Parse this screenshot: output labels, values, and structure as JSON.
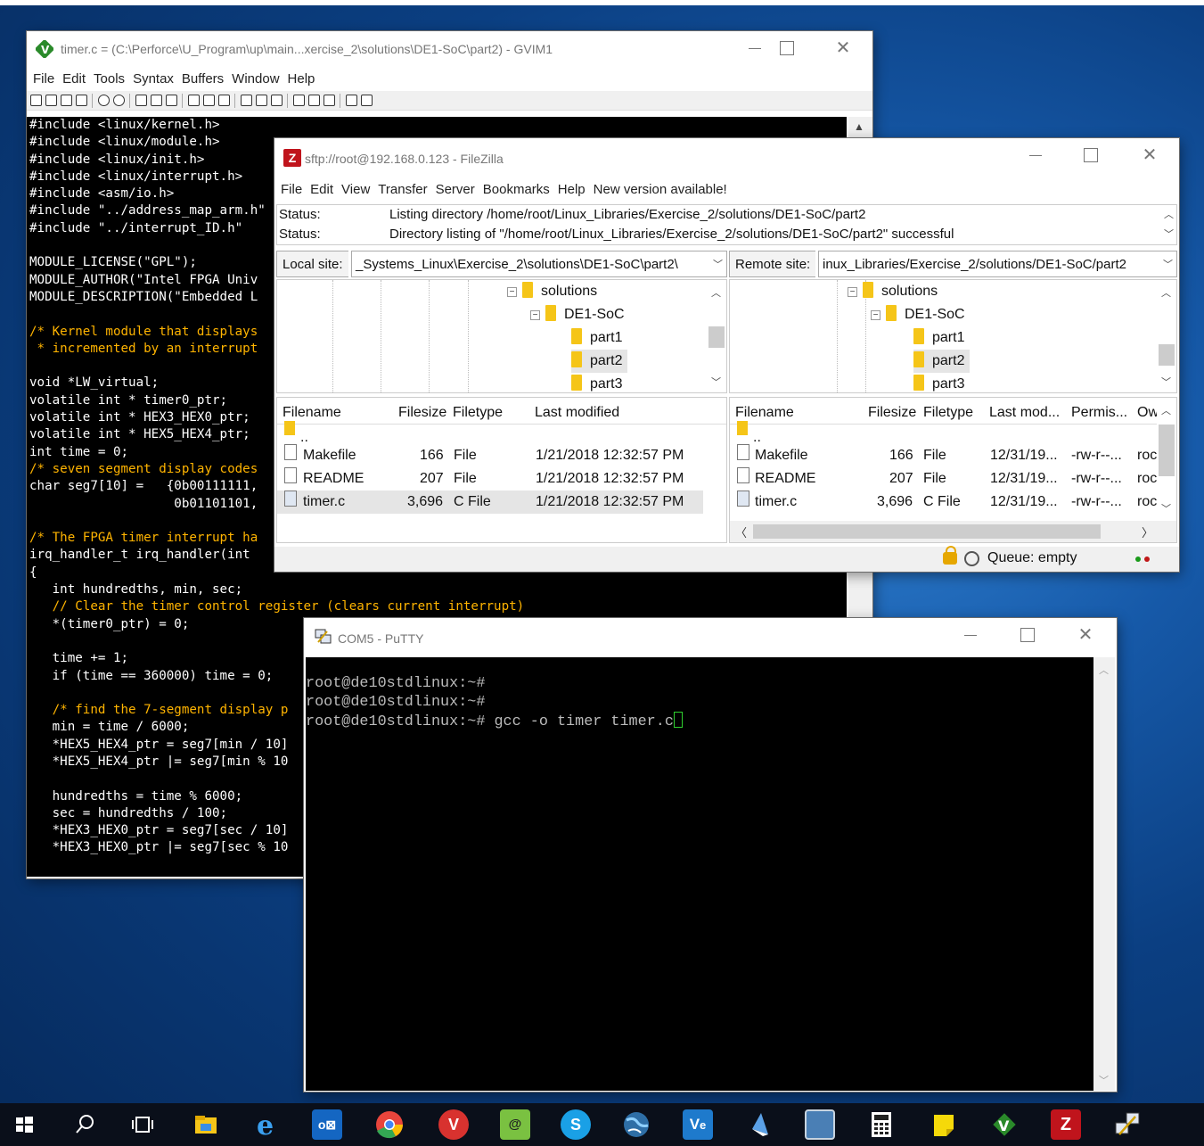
{
  "gvim": {
    "title": "timer.c = (C:\\Perforce\\U_Program\\up\\main...xercise_2\\solutions\\DE1-SoC\\part2) - GVIM1",
    "menu": [
      "File",
      "Edit",
      "Tools",
      "Syntax",
      "Buffers",
      "Window",
      "Help"
    ],
    "code_lines": [
      "#include <linux/kernel.h>",
      "#include <linux/module.h>",
      "#include <linux/init.h>",
      "#include <linux/interrupt.h>",
      "#include <asm/io.h>",
      "#include \"../address_map_arm.h\"",
      "#include \"../interrupt_ID.h\"",
      "",
      "MODULE_LICENSE(\"GPL\");",
      "MODULE_AUTHOR(\"Intel FPGA Univ",
      "MODULE_DESCRIPTION(\"Embedded L",
      "",
      "/* Kernel module that displays",
      " * incremented by an interrupt",
      "",
      "void *LW_virtual;",
      "volatile int * timer0_ptr;",
      "volatile int * HEX3_HEX0_ptr;",
      "volatile int * HEX5_HEX4_ptr;",
      "int time = 0;",
      "/* seven segment display codes",
      "char seg7[10] =   {0b00111111,",
      "                   0b01101101,",
      "",
      "/* The FPGA timer interrupt ha",
      "irq_handler_t irq_handler(int",
      "{",
      "   int hundredths, min, sec;",
      "   // Clear the timer control register (clears current interrupt)",
      "   *(timer0_ptr) = 0;",
      "",
      "   time += 1;",
      "   if (time == 360000) time = 0;",
      "",
      "   /* find the 7-segment display p",
      "   min = time / 6000;",
      "   *HEX5_HEX4_ptr = seg7[min / 10]",
      "   *HEX5_HEX4_ptr |= seg7[min % 10",
      "",
      "   hundredths = time % 6000;",
      "   sec = hundredths / 100;",
      "   *HEX3_HEX0_ptr = seg7[sec / 10]",
      "   *HEX3_HEX0_ptr |= seg7[sec % 10"
    ]
  },
  "filezilla": {
    "title": "sftp://root@192.168.0.123 - FileZilla",
    "menu": [
      "File",
      "Edit",
      "View",
      "Transfer",
      "Server",
      "Bookmarks",
      "Help",
      "New version available!"
    ],
    "log": [
      {
        "key": "Status:",
        "value": "Listing directory /home/root/Linux_Libraries/Exercise_2/solutions/DE1-SoC/part2"
      },
      {
        "key": "Status:",
        "value": "Directory listing of \"/home/root/Linux_Libraries/Exercise_2/solutions/DE1-SoC/part2\" successful"
      }
    ],
    "local_label": "Local site:",
    "local_path": "_Systems_Linux\\Exercise_2\\solutions\\DE1-SoC\\part2\\",
    "remote_label": "Remote site:",
    "remote_path": "inux_Libraries/Exercise_2/solutions/DE1-SoC/part2",
    "tree": {
      "solutions": "solutions",
      "de1soc": "DE1-SoC",
      "part1": "part1",
      "part2": "part2",
      "part3": "part3"
    },
    "local_cols": {
      "name": "Filename",
      "size": "Filesize",
      "type": "Filetype",
      "modified": "Last modified"
    },
    "remote_cols": {
      "name": "Filename",
      "size": "Filesize",
      "type": "Filetype",
      "modified": "Last mod...",
      "perms": "Permis...",
      "owner": "Ow"
    },
    "parent_dir": "..",
    "local_files": [
      {
        "name": "Makefile",
        "size": "166",
        "type": "File",
        "modified": "1/21/2018 12:32:57 PM"
      },
      {
        "name": "README",
        "size": "207",
        "type": "File",
        "modified": "1/21/2018 12:32:57 PM"
      },
      {
        "name": "timer.c",
        "size": "3,696",
        "type": "C File",
        "modified": "1/21/2018 12:32:57 PM"
      }
    ],
    "remote_files": [
      {
        "name": "Makefile",
        "size": "166",
        "type": "File",
        "modified": "12/31/19...",
        "perms": "-rw-r--...",
        "owner": "roc"
      },
      {
        "name": "README",
        "size": "207",
        "type": "File",
        "modified": "12/31/19...",
        "perms": "-rw-r--...",
        "owner": "roc"
      },
      {
        "name": "timer.c",
        "size": "3,696",
        "type": "C File",
        "modified": "12/31/19...",
        "perms": "-rw-r--...",
        "owner": "roc"
      }
    ],
    "queue": "Queue: empty"
  },
  "putty": {
    "title": "COM5 - PuTTY",
    "lines": [
      "root@de10stdlinux:~#",
      "root@de10stdlinux:~#"
    ],
    "prompt": "root@de10stdlinux:~# ",
    "command": "gcc -o timer timer.c"
  },
  "taskbar": {
    "items": [
      "windows-start",
      "search",
      "task-view",
      "file-explorer",
      "internet-explorer",
      "outlook",
      "chrome",
      "vivaldi",
      "keepass",
      "skype",
      "network",
      "visual-studio-code",
      "pen-tool",
      "image-viewer",
      "calculator",
      "sticky-notes",
      "gvim",
      "filezilla",
      "putty"
    ]
  }
}
